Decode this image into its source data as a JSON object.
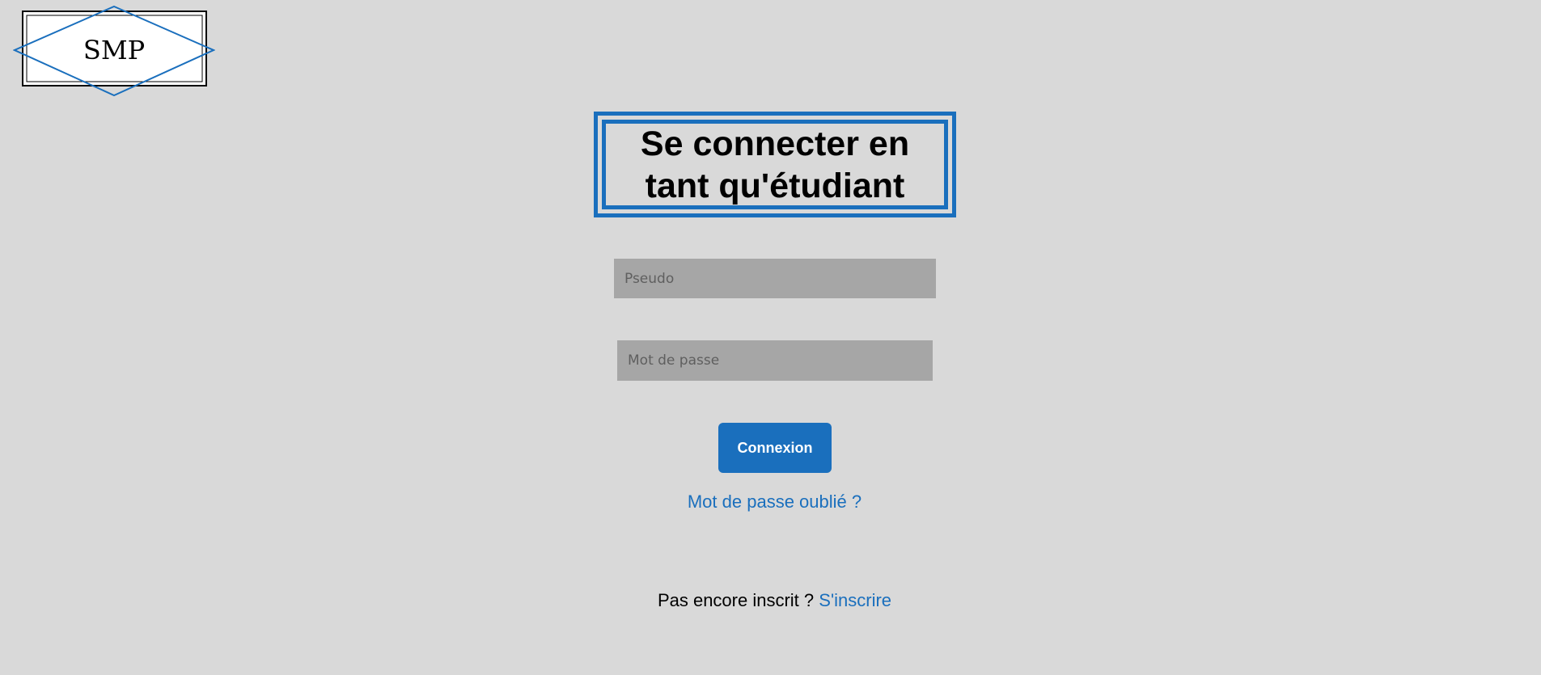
{
  "logo": {
    "text": "SMP",
    "accent_color": "#1a6fbd"
  },
  "title": {
    "line1": "Se connecter en",
    "line2": "tant qu'étudiant"
  },
  "form": {
    "pseudo_placeholder": "Pseudo",
    "password_placeholder": "Mot de passe",
    "submit_label": "Connexion"
  },
  "links": {
    "forgot_password": "Mot de passe oublié ?",
    "signup_prompt": "Pas encore inscrit ?",
    "signup_link": "S'inscrire"
  },
  "colors": {
    "background": "#d9d9d9",
    "accent": "#1a6fbd",
    "input_background": "#a6a6a6"
  }
}
